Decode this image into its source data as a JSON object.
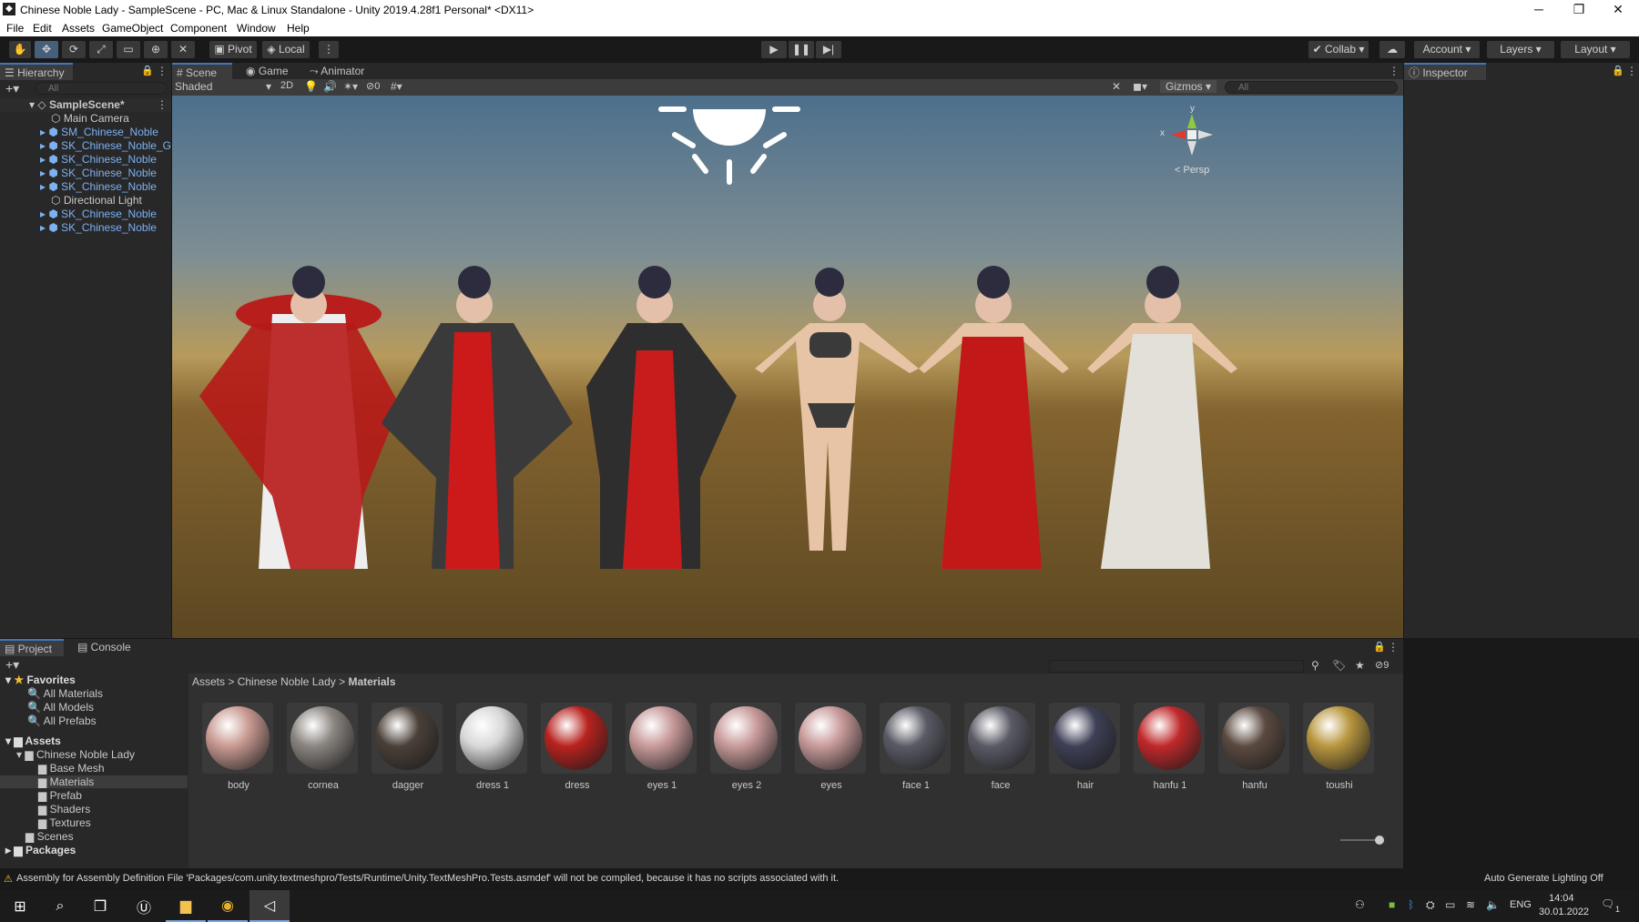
{
  "window": {
    "title": "Chinese Noble Lady - SampleScene - PC, Mac & Linux Standalone - Unity 2019.4.28f1 Personal* <DX11>",
    "app_icon": "unity-icon"
  },
  "menu": [
    "File",
    "Edit",
    "Assets",
    "GameObject",
    "Component",
    "Window",
    "Help"
  ],
  "toolbar": {
    "pivot": "Pivot",
    "local": "Local",
    "collab": "Collab",
    "account": "Account",
    "layers": "Layers",
    "layout": "Layout"
  },
  "hierarchy": {
    "tab": "Hierarchy",
    "search_placeholder": "All",
    "scene": "SampleScene*",
    "items": [
      {
        "label": "Main Camera",
        "blue": false
      },
      {
        "label": "SM_Chinese_Noble",
        "blue": true
      },
      {
        "label": "SK_Chinese_Noble_Gi",
        "blue": true
      },
      {
        "label": "SK_Chinese_Noble",
        "blue": true
      },
      {
        "label": "SK_Chinese_Noble",
        "blue": true
      },
      {
        "label": "SK_Chinese_Noble",
        "blue": true
      },
      {
        "label": "Directional Light",
        "blue": false
      },
      {
        "label": "SK_Chinese_Noble",
        "blue": true
      },
      {
        "label": "SK_Chinese_Noble",
        "blue": true
      }
    ]
  },
  "scene": {
    "tabs": [
      "Scene",
      "Game",
      "Animator"
    ],
    "shading": "Shaded",
    "mode_2d": "2D",
    "hidden_count": "0",
    "gizmos": "Gizmos",
    "search_placeholder": "All",
    "persp": "< Persp",
    "axis_x": "x",
    "axis_y": "y"
  },
  "inspector": {
    "tab": "Inspector"
  },
  "project": {
    "tabs": [
      "Project",
      "Console"
    ],
    "favorites": "Favorites",
    "fav_items": [
      "All Materials",
      "All Models",
      "All Prefabs"
    ],
    "assets": "Assets",
    "folder": "Chinese Noble Lady",
    "subfolders": [
      "Base Mesh",
      "Materials",
      "Prefab",
      "Shaders",
      "Textures"
    ],
    "scenes": "Scenes",
    "packages": "Packages",
    "breadcrumb": [
      "Assets",
      "Chinese Noble Lady",
      "Materials"
    ],
    "hidden_count": "9",
    "materials": [
      {
        "name": "body",
        "color": "#c99a92"
      },
      {
        "name": "cornea",
        "color": "#8a8580"
      },
      {
        "name": "dagger",
        "color": "#4a4038"
      },
      {
        "name": "dress 1",
        "color": "#d8d8d8"
      },
      {
        "name": "dress",
        "color": "#b8221e"
      },
      {
        "name": "eyes 1",
        "color": "#c89a9a"
      },
      {
        "name": "eyes 2",
        "color": "#c89a9a"
      },
      {
        "name": "eyes",
        "color": "#c89a9a"
      },
      {
        "name": "face 1",
        "color": "#5a5a66"
      },
      {
        "name": "face",
        "color": "#5a5a66"
      },
      {
        "name": "hair",
        "color": "#3e4056"
      },
      {
        "name": "hanfu 1",
        "color": "#c0282a"
      },
      {
        "name": "hanfu",
        "color": "#5a4a40"
      },
      {
        "name": "toushi",
        "color": "#b8963e"
      }
    ]
  },
  "status": {
    "warning": "Assembly for Assembly Definition File 'Packages/com.unity.textmeshpro/Tests/Runtime/Unity.TextMeshPro.Tests.asmdef' will not be compiled, because it has no scripts associated with it.",
    "lighting": "Auto Generate Lighting Off"
  },
  "taskbar": {
    "lang": "ENG",
    "time": "14:04",
    "date": "30.01.2022",
    "notif": "1"
  }
}
